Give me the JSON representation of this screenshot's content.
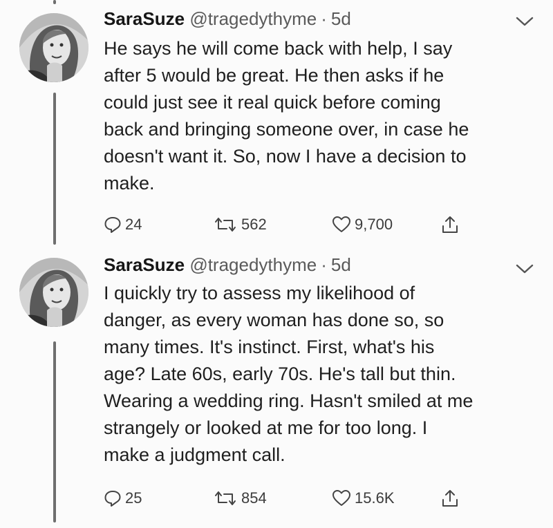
{
  "tweets": [
    {
      "name": "SaraSuze",
      "handle": "@tragedythyme",
      "separator": "·",
      "time": "5d",
      "text": "He says he will come back with help, I say\nafter 5 would be great. He then asks if he\ncould just see it real quick before coming\nback and bringing someone over, in case he\ndoesn't want it. So, now I have a decision to\nmake.",
      "replies": "24",
      "retweets": "562",
      "likes": "9,700"
    },
    {
      "name": "SaraSuze",
      "handle": "@tragedythyme",
      "separator": "·",
      "time": "5d",
      "text": "I quickly try to assess my likelihood of\ndanger, as every woman has done so, so\nmany times. It's instinct. First, what's his\nage? Late 60s, early 70s. He's tall but thin.\nWearing a wedding ring. Hasn't smiled at me\nstrangely or looked at me for too long. I\nmake a judgment call.",
      "replies": "25",
      "retweets": "854",
      "likes": "15.6K"
    }
  ],
  "icons": {
    "reply": "reply-icon",
    "retweet": "retweet-icon",
    "like": "heart-icon",
    "share": "share-icon",
    "menu": "chevron-down-icon"
  },
  "colors": {
    "background": "#fbfbfb",
    "text": "#1f1f1f",
    "muted": "#5a5a5a",
    "thread_line": "#6e6e6e"
  }
}
